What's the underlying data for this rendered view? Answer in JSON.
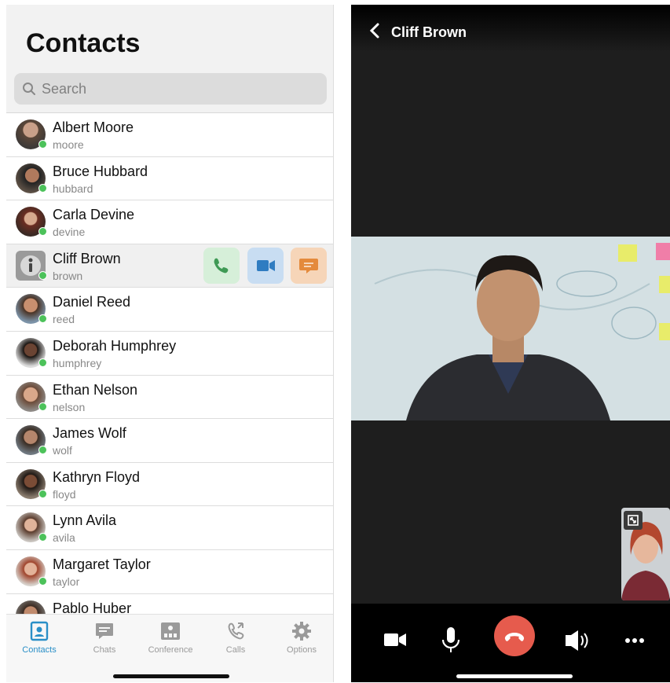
{
  "left": {
    "title": "Contacts",
    "search": {
      "placeholder": "Search",
      "icon": "search-icon"
    },
    "contacts": [
      {
        "name": "Albert Moore",
        "username": "moore",
        "status": "online"
      },
      {
        "name": "Bruce Hubbard",
        "username": "hubbard",
        "status": "online"
      },
      {
        "name": "Carla Devine",
        "username": "devine",
        "status": "online"
      },
      {
        "name": "Cliff Brown",
        "username": "brown",
        "status": "online",
        "selected": true
      },
      {
        "name": "Daniel Reed",
        "username": "reed",
        "status": "online"
      },
      {
        "name": "Deborah Humphrey",
        "username": "humphrey",
        "status": "online"
      },
      {
        "name": "Ethan Nelson",
        "username": "nelson",
        "status": "online"
      },
      {
        "name": "James Wolf",
        "username": "wolf",
        "status": "online"
      },
      {
        "name": "Kathryn Floyd",
        "username": "floyd",
        "status": "online"
      },
      {
        "name": "Lynn Avila",
        "username": "avila",
        "status": "online"
      },
      {
        "name": "Margaret Taylor",
        "username": "taylor",
        "status": "online"
      },
      {
        "name": "Pablo Huber",
        "username": "",
        "status": "online"
      }
    ],
    "row_actions": [
      {
        "icon": "phone-icon",
        "color": "#d6efd9"
      },
      {
        "icon": "video-camera-icon",
        "color": "#c8ddf2"
      },
      {
        "icon": "chat-icon",
        "color": "#f6d5b8"
      }
    ],
    "tabs": [
      {
        "label": "Contacts",
        "icon": "contacts-icon",
        "active": true
      },
      {
        "label": "Chats",
        "icon": "chat-icon"
      },
      {
        "label": "Conference",
        "icon": "conference-icon"
      },
      {
        "label": "Calls",
        "icon": "calls-icon"
      },
      {
        "label": "Options",
        "icon": "gear-icon"
      }
    ],
    "colors": {
      "accent": "#2a8fc7",
      "online": "#4cc25a"
    }
  },
  "right": {
    "header": {
      "back_icon": "chevron-left-icon",
      "contact_name": "Cliff Brown"
    },
    "controls": [
      {
        "icon": "video-camera-icon"
      },
      {
        "icon": "microphone-icon"
      },
      {
        "icon": "hang-up-icon",
        "color": "#e65b4d"
      },
      {
        "icon": "speaker-icon"
      },
      {
        "icon": "more-icon"
      }
    ]
  }
}
